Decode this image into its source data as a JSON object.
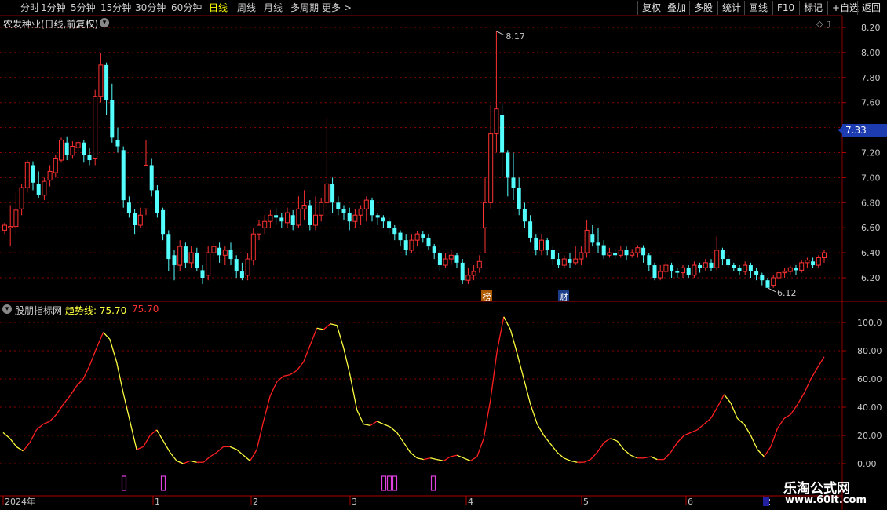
{
  "toolbar": {
    "tabs": [
      "分时",
      "1分钟",
      "5分钟",
      "15分钟",
      "30分钟",
      "60分钟",
      "日线",
      "周线",
      "月线",
      "多周期",
      "更多 >"
    ],
    "active_tab": "日线",
    "right_buttons": [
      "复权",
      "叠加",
      "多股",
      "统计",
      "画线",
      "F10",
      "标记",
      "+自选",
      "返回"
    ]
  },
  "main_chart": {
    "title": "农发种业(日线,前复权)",
    "y_ticks": [
      "8.20",
      "8.00",
      "7.80",
      "7.60",
      "7.40",
      "7.20",
      "7.00",
      "6.80",
      "6.60",
      "6.40",
      "6.20"
    ],
    "current_price": "7.33",
    "high_label": "8.17",
    "low_label": "6.12",
    "markers": [
      "榜",
      "财"
    ]
  },
  "indicator": {
    "source": "股朋指标网",
    "line_label": "趋势线: 75.70",
    "line_value": "75.70",
    "y_ticks": [
      "100.0",
      "80.00",
      "60.00",
      "40.00",
      "20.00",
      "0.00"
    ]
  },
  "time_axis": {
    "labels": [
      "2024年",
      "1",
      "2",
      "3",
      "4",
      "5",
      "6",
      "2"
    ]
  },
  "watermark": {
    "name": "乐淘公式网",
    "url": "www.60lt.com"
  },
  "colors": {
    "up": "#ff3232",
    "down": "#54ffff",
    "grid": "#8b0000",
    "trend_up": "#ff2020",
    "trend_down": "#ffff40",
    "signal": "#e040e0"
  },
  "chart_data": {
    "type": "candlestick",
    "ylim": [
      6.1,
      8.25
    ],
    "candles": [
      [
        6.58,
        6.62,
        6.55,
        6.64
      ],
      [
        6.6,
        6.61,
        6.45,
        6.78
      ],
      [
        6.61,
        6.74,
        6.55,
        6.88
      ],
      [
        6.75,
        6.92,
        6.7,
        6.95
      ],
      [
        6.92,
        7.12,
        6.88,
        7.14
      ],
      [
        7.1,
        6.96,
        6.9,
        7.13
      ],
      [
        6.95,
        6.86,
        6.84,
        7.05
      ],
      [
        6.86,
        6.97,
        6.82,
        7.0
      ],
      [
        6.98,
        7.05,
        6.93,
        7.1
      ],
      [
        7.04,
        7.15,
        7.0,
        7.18
      ],
      [
        7.14,
        7.3,
        7.12,
        7.32
      ],
      [
        7.28,
        7.18,
        7.14,
        7.33
      ],
      [
        7.18,
        7.25,
        7.15,
        7.29
      ],
      [
        7.24,
        7.28,
        7.2,
        7.3
      ],
      [
        7.28,
        7.18,
        7.12,
        7.3
      ],
      [
        7.18,
        7.14,
        7.1,
        7.24
      ],
      [
        7.15,
        7.65,
        7.1,
        7.7
      ],
      [
        7.65,
        7.9,
        7.6,
        8.0
      ],
      [
        7.9,
        7.62,
        7.5,
        7.92
      ],
      [
        7.62,
        7.32,
        7.28,
        7.75
      ],
      [
        7.3,
        7.25,
        7.2,
        7.4
      ],
      [
        7.22,
        6.82,
        6.76,
        7.25
      ],
      [
        6.8,
        6.72,
        6.68,
        6.85
      ],
      [
        6.72,
        6.62,
        6.55,
        6.75
      ],
      [
        6.62,
        6.7,
        6.6,
        6.76
      ],
      [
        6.75,
        7.1,
        6.7,
        7.3
      ],
      [
        7.1,
        6.9,
        6.85,
        7.15
      ],
      [
        6.9,
        6.72,
        6.68,
        6.94
      ],
      [
        6.74,
        6.55,
        6.5,
        6.76
      ],
      [
        6.55,
        6.35,
        6.25,
        6.58
      ],
      [
        6.38,
        6.3,
        6.18,
        6.42
      ],
      [
        6.3,
        6.45,
        6.25,
        6.5
      ],
      [
        6.45,
        6.32,
        6.28,
        6.48
      ],
      [
        6.32,
        6.4,
        6.28,
        6.45
      ],
      [
        6.4,
        6.28,
        6.25,
        6.44
      ],
      [
        6.26,
        6.2,
        6.15,
        6.3
      ],
      [
        6.22,
        6.4,
        6.18,
        6.45
      ],
      [
        6.4,
        6.45,
        6.35,
        6.48
      ],
      [
        6.44,
        6.38,
        6.32,
        6.48
      ],
      [
        6.38,
        6.42,
        6.3,
        6.45
      ],
      [
        6.42,
        6.35,
        6.3,
        6.48
      ],
      [
        6.35,
        6.25,
        6.2,
        6.38
      ],
      [
        6.25,
        6.2,
        6.18,
        6.32
      ],
      [
        6.22,
        6.35,
        6.18,
        6.4
      ],
      [
        6.34,
        6.55,
        6.3,
        6.6
      ],
      [
        6.55,
        6.62,
        6.5,
        6.66
      ],
      [
        6.6,
        6.65,
        6.55,
        6.7
      ],
      [
        6.65,
        6.7,
        6.6,
        6.74
      ],
      [
        6.7,
        6.68,
        6.62,
        6.76
      ],
      [
        6.68,
        6.65,
        6.6,
        6.72
      ],
      [
        6.64,
        6.72,
        6.6,
        6.76
      ],
      [
        6.7,
        6.62,
        6.58,
        6.74
      ],
      [
        6.62,
        6.75,
        6.6,
        6.85
      ],
      [
        6.75,
        6.78,
        6.66,
        6.9
      ],
      [
        6.78,
        6.62,
        6.58,
        6.82
      ],
      [
        6.62,
        6.7,
        6.58,
        6.85
      ],
      [
        6.7,
        6.8,
        6.65,
        6.84
      ],
      [
        6.8,
        6.95,
        6.75,
        7.48
      ],
      [
        6.95,
        6.8,
        6.72,
        7.0
      ],
      [
        6.8,
        6.75,
        6.7,
        6.85
      ],
      [
        6.75,
        6.72,
        6.66,
        6.78
      ],
      [
        6.72,
        6.65,
        6.58,
        6.76
      ],
      [
        6.65,
        6.7,
        6.6,
        6.75
      ],
      [
        6.7,
        6.75,
        6.62,
        6.78
      ],
      [
        6.75,
        6.82,
        6.65,
        6.85
      ],
      [
        6.82,
        6.7,
        6.65,
        6.84
      ],
      [
        6.7,
        6.68,
        6.62,
        6.72
      ],
      [
        6.68,
        6.65,
        6.6,
        6.7
      ],
      [
        6.65,
        6.6,
        6.55,
        6.68
      ],
      [
        6.6,
        6.55,
        6.5,
        6.62
      ],
      [
        6.56,
        6.5,
        6.45,
        6.58
      ],
      [
        6.5,
        6.42,
        6.38,
        6.55
      ],
      [
        6.42,
        6.5,
        6.4,
        6.55
      ],
      [
        6.5,
        6.55,
        6.45,
        6.57
      ],
      [
        6.55,
        6.52,
        6.48,
        6.57
      ],
      [
        6.52,
        6.45,
        6.42,
        6.55
      ],
      [
        6.45,
        6.4,
        6.35,
        6.47
      ],
      [
        6.4,
        6.3,
        6.25,
        6.42
      ],
      [
        6.3,
        6.35,
        6.28,
        6.4
      ],
      [
        6.35,
        6.38,
        6.3,
        6.42
      ],
      [
        6.38,
        6.32,
        6.28,
        6.4
      ],
      [
        6.32,
        6.18,
        6.15,
        6.35
      ],
      [
        6.18,
        6.22,
        6.15,
        6.28
      ],
      [
        6.22,
        6.25,
        6.18,
        6.3
      ],
      [
        6.28,
        6.33,
        6.24,
        6.38
      ],
      [
        6.6,
        6.8,
        6.4,
        7.0
      ],
      [
        6.8,
        7.35,
        6.75,
        7.58
      ],
      [
        7.35,
        7.55,
        7.2,
        8.17
      ],
      [
        7.5,
        7.2,
        7.0,
        7.6
      ],
      [
        7.2,
        7.0,
        6.85,
        7.22
      ],
      [
        7.0,
        6.92,
        6.82,
        7.2
      ],
      [
        6.92,
        6.75,
        6.7,
        7.0
      ],
      [
        6.75,
        6.65,
        6.6,
        6.8
      ],
      [
        6.65,
        6.52,
        6.48,
        6.7
      ],
      [
        6.52,
        6.42,
        6.38,
        6.55
      ],
      [
        6.42,
        6.5,
        6.38,
        6.55
      ],
      [
        6.5,
        6.42,
        6.38,
        6.52
      ],
      [
        6.42,
        6.35,
        6.3,
        6.45
      ],
      [
        6.35,
        6.3,
        6.28,
        6.4
      ],
      [
        6.3,
        6.35,
        6.28,
        6.38
      ],
      [
        6.35,
        6.32,
        6.28,
        6.4
      ],
      [
        6.32,
        6.35,
        6.3,
        6.45
      ],
      [
        6.35,
        6.4,
        6.3,
        6.45
      ],
      [
        6.4,
        6.58,
        6.36,
        6.66
      ],
      [
        6.55,
        6.48,
        6.45,
        6.62
      ],
      [
        6.48,
        6.46,
        6.4,
        6.6
      ],
      [
        6.46,
        6.38,
        6.35,
        6.5
      ],
      [
        6.38,
        6.4,
        6.36,
        6.44
      ],
      [
        6.4,
        6.38,
        6.35,
        6.43
      ],
      [
        6.38,
        6.42,
        6.36,
        6.45
      ],
      [
        6.42,
        6.38,
        6.34,
        6.45
      ],
      [
        6.38,
        6.4,
        6.36,
        6.43
      ],
      [
        6.4,
        6.44,
        6.36,
        6.46
      ],
      [
        6.44,
        6.38,
        6.32,
        6.46
      ],
      [
        6.38,
        6.3,
        6.25,
        6.4
      ],
      [
        6.3,
        6.2,
        6.18,
        6.32
      ],
      [
        6.2,
        6.25,
        6.18,
        6.3
      ],
      [
        6.25,
        6.3,
        6.22,
        6.33
      ],
      [
        6.3,
        6.25,
        6.2,
        6.32
      ],
      [
        6.25,
        6.24,
        6.2,
        6.28
      ],
      [
        6.24,
        6.28,
        6.2,
        6.3
      ],
      [
        6.28,
        6.22,
        6.2,
        6.3
      ],
      [
        6.22,
        6.3,
        6.2,
        6.33
      ],
      [
        6.3,
        6.28,
        6.24,
        6.32
      ],
      [
        6.28,
        6.32,
        6.25,
        6.35
      ],
      [
        6.32,
        6.28,
        6.25,
        6.35
      ],
      [
        6.28,
        6.42,
        6.26,
        6.53
      ],
      [
        6.42,
        6.35,
        6.3,
        6.44
      ],
      [
        6.35,
        6.3,
        6.28,
        6.38
      ],
      [
        6.3,
        6.28,
        6.25,
        6.32
      ],
      [
        6.28,
        6.25,
        6.22,
        6.3
      ],
      [
        6.25,
        6.3,
        6.22,
        6.33
      ],
      [
        6.3,
        6.25,
        6.2,
        6.32
      ],
      [
        6.25,
        6.22,
        6.18,
        6.28
      ],
      [
        6.22,
        6.18,
        6.14,
        6.24
      ],
      [
        6.18,
        6.12,
        6.12,
        6.2
      ],
      [
        6.14,
        6.2,
        6.12,
        6.22
      ],
      [
        6.2,
        6.24,
        6.18,
        6.26
      ],
      [
        6.24,
        6.25,
        6.2,
        6.28
      ],
      [
        6.25,
        6.28,
        6.22,
        6.3
      ],
      [
        6.28,
        6.26,
        6.22,
        6.3
      ],
      [
        6.26,
        6.32,
        6.24,
        6.34
      ],
      [
        6.32,
        6.34,
        6.28,
        6.36
      ],
      [
        6.33,
        6.3,
        6.28,
        6.36
      ],
      [
        6.3,
        6.36,
        6.28,
        6.38
      ],
      [
        6.36,
        6.4,
        6.32,
        6.42
      ]
    ],
    "trend": [
      22,
      18,
      12,
      9,
      15,
      24,
      28,
      30,
      35,
      42,
      48,
      55,
      60,
      70,
      82,
      93,
      88,
      72,
      50,
      30,
      10,
      12,
      20,
      24,
      16,
      8,
      2,
      0,
      2,
      1,
      1,
      5,
      8,
      12,
      12,
      10,
      6,
      2,
      10,
      30,
      48,
      58,
      62,
      63,
      66,
      72,
      84,
      96,
      95,
      99,
      98,
      82,
      62,
      38,
      28,
      27,
      30,
      28,
      26,
      22,
      15,
      8,
      4,
      3,
      4,
      3,
      2,
      5,
      6,
      4,
      2,
      5,
      18,
      45,
      80,
      104,
      95,
      78,
      60,
      42,
      28,
      20,
      14,
      8,
      4,
      2,
      1,
      1,
      3,
      8,
      15,
      18,
      16,
      10,
      6,
      4,
      4,
      5,
      3,
      3,
      8,
      15,
      20,
      22,
      24,
      28,
      32,
      40,
      49,
      43,
      32,
      28,
      20,
      10,
      5,
      12,
      25,
      32,
      35,
      42,
      50,
      60,
      68,
      75.7
    ]
  }
}
